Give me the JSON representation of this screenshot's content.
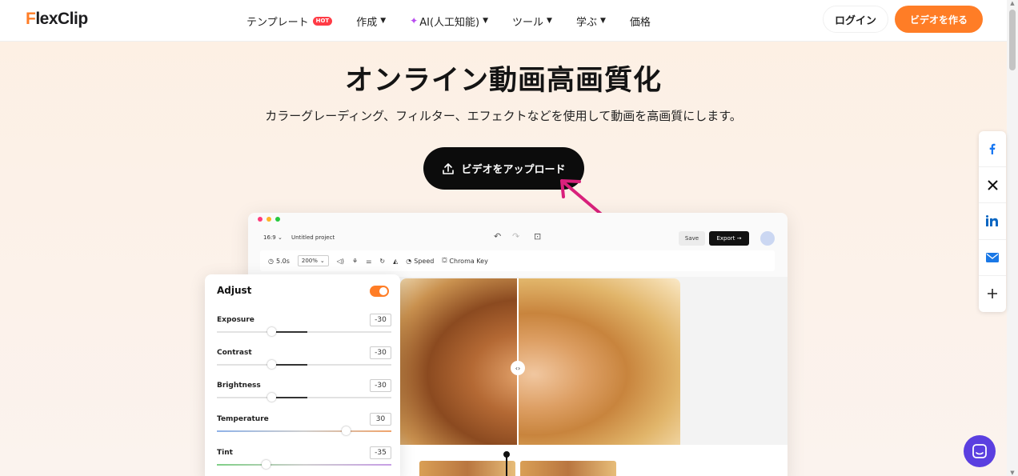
{
  "navbar": {
    "logo": "FlexClip",
    "items": [
      {
        "label": "テンプレート",
        "badge": "HOT"
      },
      {
        "label": "作成"
      },
      {
        "label": "AI(人工知能)"
      },
      {
        "label": "ツール"
      },
      {
        "label": "学ぶ"
      },
      {
        "label": "価格"
      }
    ],
    "login_label": "ログイン",
    "create_label": "ビデオを作る"
  },
  "hero": {
    "title": "オンライン動画高画質化",
    "subtitle": "カラーグレーディング、フィルター、エフェクトなどを使用して動画を高画質にします。",
    "upload_label": "ビデオをアップロード"
  },
  "editor": {
    "ratio": "16:9",
    "project_name": "Untitled project",
    "save_label": "Save",
    "export_label": "Export →",
    "duration": "5.0s",
    "zoom": "200%",
    "speed_label": "Speed",
    "chroma_label": "Chroma Key"
  },
  "adjust": {
    "title": "Adjust",
    "enabled": true,
    "rows": [
      {
        "label": "Exposure",
        "value": "-30",
        "level": 0.35
      },
      {
        "label": "Contrast",
        "value": "-30",
        "level": 0.35
      },
      {
        "label": "Brightness",
        "value": "-30",
        "level": 0.35
      },
      {
        "label": "Temperature",
        "value": "30",
        "level": 0.65
      },
      {
        "label": "Tint",
        "value": "-35",
        "level": 0.33
      }
    ]
  },
  "social": [
    "facebook-icon",
    "x-icon",
    "linkedin-icon",
    "mail-icon",
    "plus-icon"
  ],
  "colors": {
    "accent": "#ff7d26",
    "hot": "#ff3b45",
    "chat": "#5a3fe0",
    "arrow": "#d9217c"
  }
}
